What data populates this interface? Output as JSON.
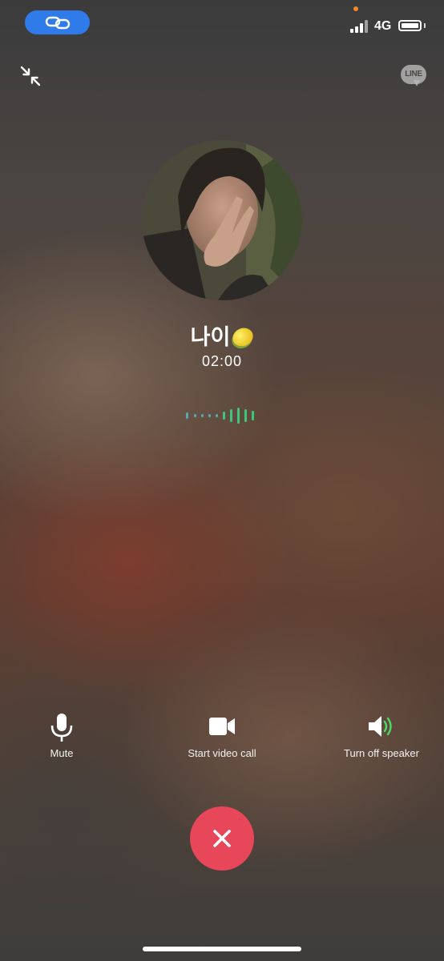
{
  "status_bar": {
    "network": "4G",
    "signal_bars": 4,
    "pill_icon": "link-icon",
    "recording_dot_color": "#f08a24"
  },
  "top_bar": {
    "minimize_icon": "collapse-arrows-icon",
    "logo_text": "LINE"
  },
  "caller": {
    "name": "나이",
    "emoji": "lemon",
    "duration": "02:00",
    "avatar_icon": "profile-photo"
  },
  "actions": [
    {
      "label": "Mute",
      "icon": "microphone-icon"
    },
    {
      "label": "Start video call",
      "icon": "video-camera-icon"
    },
    {
      "label": "Turn off speaker",
      "icon": "speaker-on-icon"
    }
  ],
  "end_call": {
    "icon": "close-x-icon",
    "color": "#e8475a"
  },
  "colors": {
    "accent_blue": "#2f7bea",
    "wave_teal": "#5aa8b0",
    "wave_green": "#3cc77a",
    "speaker_green": "#4cd964"
  }
}
